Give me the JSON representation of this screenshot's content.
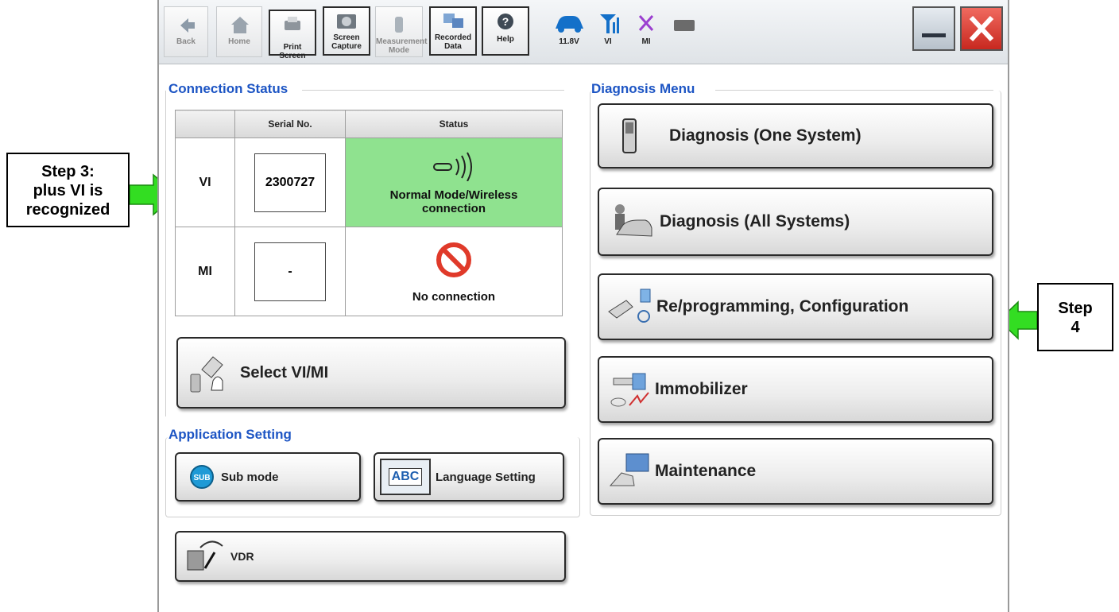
{
  "toolbar": {
    "back": "Back",
    "home": "Home",
    "print_screen": "Print Screen",
    "screen_capture_line1": "Screen",
    "screen_capture_line2": "Capture",
    "measurement_line1": "Measurement",
    "measurement_line2": "Mode",
    "recorded_line1": "Recorded",
    "recorded_line2": "Data",
    "help": "Help",
    "battery_voltage": "11.8V",
    "vi_label": "VI",
    "mi_label": "MI"
  },
  "connection_status": {
    "title": "Connection Status",
    "headers": [
      "",
      "Serial No.",
      "Status"
    ],
    "rows": [
      {
        "device": "VI",
        "serial": "2300727",
        "status": "Normal Mode/Wireless connection",
        "status_color": "#8fe28f"
      },
      {
        "device": "MI",
        "serial": "-",
        "status": "No connection"
      }
    ]
  },
  "select_button": "Select VI/MI",
  "application_setting": {
    "title": "Application Setting",
    "sub_mode": "Sub mode",
    "sub_icon_text": "SUB",
    "language_setting": "Language Setting",
    "language_icon_text": "ABC"
  },
  "vdr_button": "VDR",
  "diagnosis_menu": {
    "title": "Diagnosis Menu",
    "items": [
      "Diagnosis (One System)",
      "Diagnosis (All Systems)",
      "Re/programming, Configuration",
      "Immobilizer",
      "Maintenance"
    ]
  },
  "callouts": {
    "step3_line1": "Step 3:",
    "step3_line2": "plus VI is",
    "step3_line3": "recognized",
    "step4_line1": "Step",
    "step4_line2": "4"
  },
  "colors": {
    "accent_title": "#1d55c4",
    "arrow_green": "#33dd22",
    "status_green": "#8fe28f",
    "close_red": "#e0392f"
  }
}
